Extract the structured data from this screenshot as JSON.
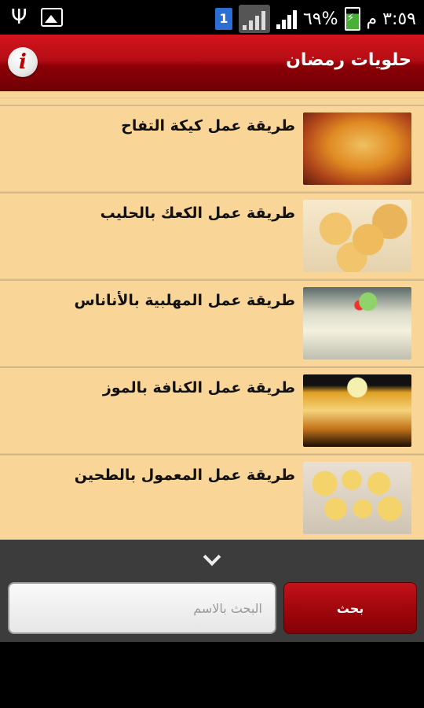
{
  "status_bar": {
    "sim_number": "1",
    "battery_percent": "٦٩%",
    "time": "٣:٥٩ م",
    "icons": [
      "usb-icon",
      "gallery-icon",
      "sim-icon",
      "signal-box-icon",
      "signal-bars-icon",
      "battery-icon"
    ]
  },
  "header": {
    "title": "حلويات رمضان",
    "info_icon_glyph": "i"
  },
  "recipes": [
    {
      "label": "طريقة عمل كيكة التفاح",
      "thumb": "apple-cake"
    },
    {
      "label": "طريقة عمل الكعك بالحليب",
      "thumb": "milk-cookies"
    },
    {
      "label": "طريقة عمل المهلبية بالأناناس",
      "thumb": "muhallabia"
    },
    {
      "label": "طريقة عمل الكنافة بالموز",
      "thumb": "kunafa"
    },
    {
      "label": "طريقة عمل المعمول بالطحين",
      "thumb": "maamoul"
    }
  ],
  "search": {
    "placeholder": "البحث بالاسم",
    "button_label": "بحث"
  },
  "colors": {
    "header_red": "#b50d14",
    "list_bg": "#f9d598",
    "bottom_bar": "#3c3c3c"
  }
}
